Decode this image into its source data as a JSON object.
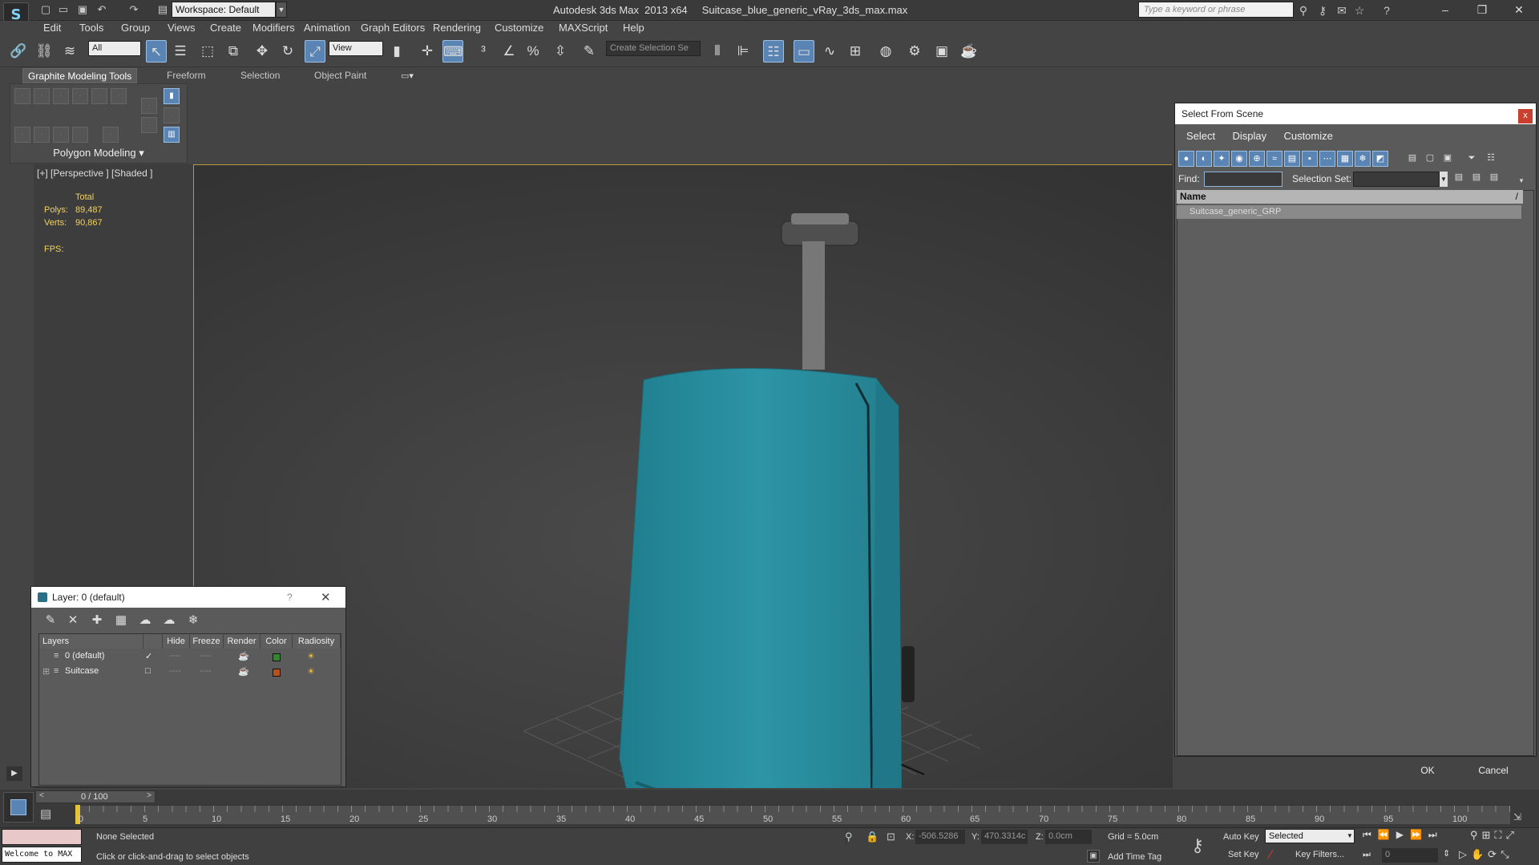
{
  "app": {
    "title": "Autodesk 3ds Max  2013 x64     Suitcase_blue_generic_vRay_3ds_max.max",
    "logo_text": "S",
    "workspace": "Workspace: Default",
    "search_placeholder": "Type a keyword or phrase"
  },
  "menu": [
    "Edit",
    "Tools",
    "Group",
    "Views",
    "Create",
    "Modifiers",
    "Animation",
    "Graph Editors",
    "Rendering",
    "Customize",
    "MAXScript",
    "Help"
  ],
  "toolbar": {
    "filter": "All",
    "ref_coord": "View",
    "selection_set": "Create Selection Se"
  },
  "ribbon": {
    "tabs": [
      "Graphite Modeling Tools",
      "Freeform",
      "Selection",
      "Object Paint"
    ],
    "panel_label": "Polygon Modeling  ▾"
  },
  "viewport": {
    "label": "[+] [Perspective ] [Shaded ]",
    "stats_title": "Total",
    "polys_label": "Polys:",
    "polys": "89,487",
    "verts_label": "Verts:",
    "verts": "90,867",
    "fps_label": "FPS:"
  },
  "select_dialog": {
    "title": "Select From Scene",
    "close": "x",
    "menu": [
      "Select",
      "Display",
      "Customize"
    ],
    "find_label": "Find:",
    "selset_label": "Selection Set:",
    "column": "Name",
    "sort_mark": "/",
    "items": [
      "Suitcase_generic_GRP"
    ],
    "ok": "OK",
    "cancel": "Cancel"
  },
  "layer_dialog": {
    "title": "Layer: 0 (default)",
    "help": "?",
    "columns": [
      "Layers",
      "Hide",
      "Freeze",
      "Render",
      "Color",
      "Radiosity"
    ],
    "rows": [
      {
        "name": "0 (default)",
        "check": "✓",
        "color": "#2f8a2f"
      },
      {
        "name": "Suitcase",
        "check": "□",
        "color": "#b5531a"
      }
    ]
  },
  "timeline": {
    "frame": "0 / 100",
    "ticks": [
      "0",
      "5",
      "10",
      "15",
      "20",
      "25",
      "30",
      "35",
      "40",
      "45",
      "50",
      "55",
      "60",
      "65",
      "70",
      "75",
      "80",
      "85",
      "90",
      "95",
      "100"
    ]
  },
  "status": {
    "maxscript": "Welcome to MAX",
    "selection": "None Selected",
    "prompt": "Click or click-and-drag to select objects",
    "x_label": "X:",
    "x": "-506.5286",
    "y_label": "Y:",
    "y": "470.3314c",
    "z_label": "Z:",
    "z": "0.0cm",
    "grid": "Grid = 5.0cm",
    "auto_key": "Auto Key",
    "set_key": "Set Key",
    "selected": "Selected",
    "key_filters": "Key Filters...",
    "add_time_tag": "Add Time Tag",
    "frame_field": "0"
  },
  "colors": {
    "accent": "#5a84b3",
    "suitcase": "#2b8fa0",
    "viewport_border": "#b89a34"
  }
}
